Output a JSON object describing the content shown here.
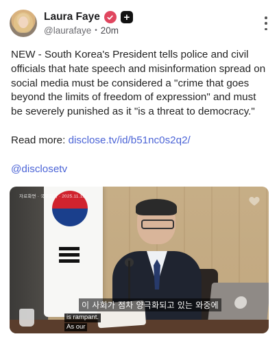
{
  "post": {
    "author": {
      "display_name": "Laura Faye",
      "handle": "@laurafaye",
      "time": "20m",
      "separator": "•"
    },
    "body_text": "NEW - South Korea's President tells police and civil officials that hate speech and misinformation spread on social media must be considered a \"crime that goes beyond the limits of freedom of expression\" and must be severely punished as it \"is a threat to democracy.\"",
    "read_more_label": "Read more:",
    "read_more_link": "disclose.tv/id/b51nc0s2q2/",
    "mention": "@disclosetv",
    "plus_badge": "+"
  },
  "media": {
    "watermark": "자료화면 · 국무회의 · 2025.11.11.",
    "subtitle_korean": "이 사회가 점차 양극화되고 있는 와중에",
    "subtitle_english_lines": [
      "is rampant.",
      "As our"
    ]
  },
  "colors": {
    "verified_badge": "#e0465f",
    "link": "#4a63d6",
    "text": "#222222",
    "meta": "#6b6b70"
  },
  "icons": {
    "verified": "verified-badge-icon",
    "plus": "plus-badge-icon",
    "more": "more-vertical-icon",
    "like_overlay": "heart-icon"
  }
}
